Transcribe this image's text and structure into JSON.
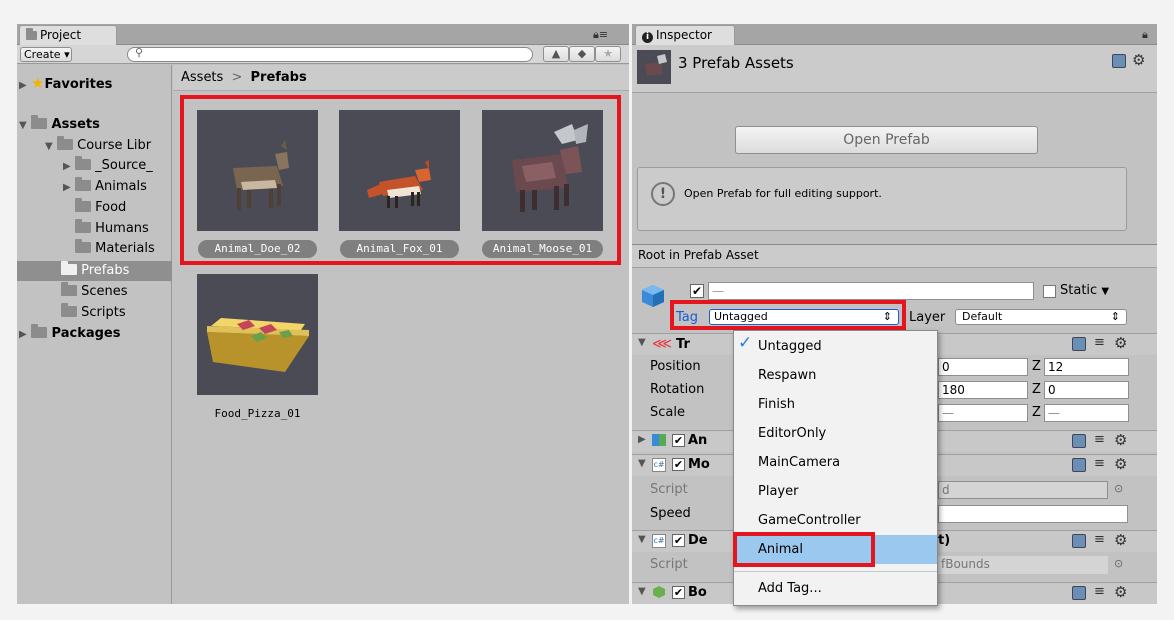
{
  "project": {
    "tab_label": "Project",
    "create_label": "Create",
    "search_placeholder": "",
    "favorites_label": "Favorites",
    "assets_label": "Assets",
    "tree": [
      {
        "label": "Course Libr"
      },
      {
        "label": "_Source_"
      },
      {
        "label": "Animals"
      },
      {
        "label": "Food"
      },
      {
        "label": "Humans"
      },
      {
        "label": "Materials"
      },
      {
        "label": "Prefabs"
      },
      {
        "label": "Scenes"
      },
      {
        "label": "Scripts"
      }
    ],
    "packages_label": "Packages",
    "breadcrumb": {
      "root": "Assets",
      "separator": ">",
      "current": "Prefabs"
    },
    "assets": [
      {
        "name": "Animal_Doe_02"
      },
      {
        "name": "Animal_Fox_01"
      },
      {
        "name": "Animal_Moose_01"
      },
      {
        "name": "Food_Pizza_01"
      }
    ]
  },
  "inspector": {
    "tab_label": "Inspector",
    "title": "3 Prefab Assets",
    "open_prefab_label": "Open Prefab",
    "info_text": "Open Prefab for full editing support.",
    "root_label": "Root in Prefab Asset",
    "name_value": "—",
    "static_label": "Static",
    "tag_label": "Tag",
    "tag_value": "Untagged",
    "layer_label": "Layer",
    "layer_value": "Default",
    "transform": {
      "title": "Tr",
      "position_label": "Position",
      "rotation_label": "Rotation",
      "scale_label": "Scale",
      "position_y": "0",
      "position_z_label": "Z",
      "position_z": "12",
      "rotation_y": "180",
      "rotation_z_label": "Z",
      "rotation_z": "0",
      "scale_y": "—",
      "scale_z_label": "Z",
      "scale_z": "—"
    },
    "comp_animator": "An",
    "comp_move": "Mo",
    "script_label": "Script",
    "script_value_partial": "d",
    "speed_label": "Speed",
    "comp_destroy": "De",
    "destroy_suffix": "t)",
    "script2_label": "Script",
    "script2_value_partial": "fBounds",
    "comp_box": "Bo"
  },
  "tag_menu": {
    "items": [
      "Untagged",
      "Respawn",
      "Finish",
      "EditorOnly",
      "MainCamera",
      "Player",
      "GameController",
      "Animal"
    ],
    "add_tag": "Add Tag...",
    "checked_index": 0,
    "highlighted_index": 7
  },
  "colors": {
    "highlight_red": "#e3151e",
    "selection_blue": "#96c7f0",
    "menu_selected": "#9bc8ef"
  }
}
